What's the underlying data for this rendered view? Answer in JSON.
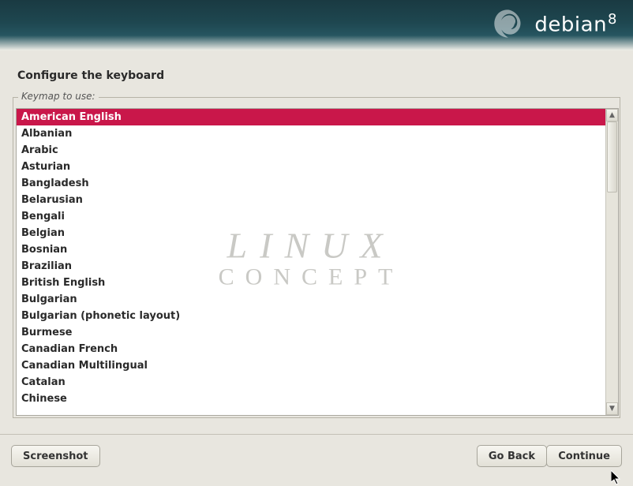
{
  "header": {
    "brand": "debian",
    "version": "8"
  },
  "page": {
    "title": "Configure the keyboard",
    "panel_label": "Keymap to use:"
  },
  "watermark": {
    "line1": "LINUX",
    "line2": "CONCEPT"
  },
  "keymaps": {
    "selected_index": 0,
    "items": [
      "American English",
      "Albanian",
      "Arabic",
      "Asturian",
      "Bangladesh",
      "Belarusian",
      "Bengali",
      "Belgian",
      "Bosnian",
      "Brazilian",
      "British English",
      "Bulgarian",
      "Bulgarian (phonetic layout)",
      "Burmese",
      "Canadian French",
      "Canadian Multilingual",
      "Catalan",
      "Chinese"
    ]
  },
  "buttons": {
    "screenshot": "Screenshot",
    "go_back": "Go Back",
    "continue": "Continue"
  }
}
